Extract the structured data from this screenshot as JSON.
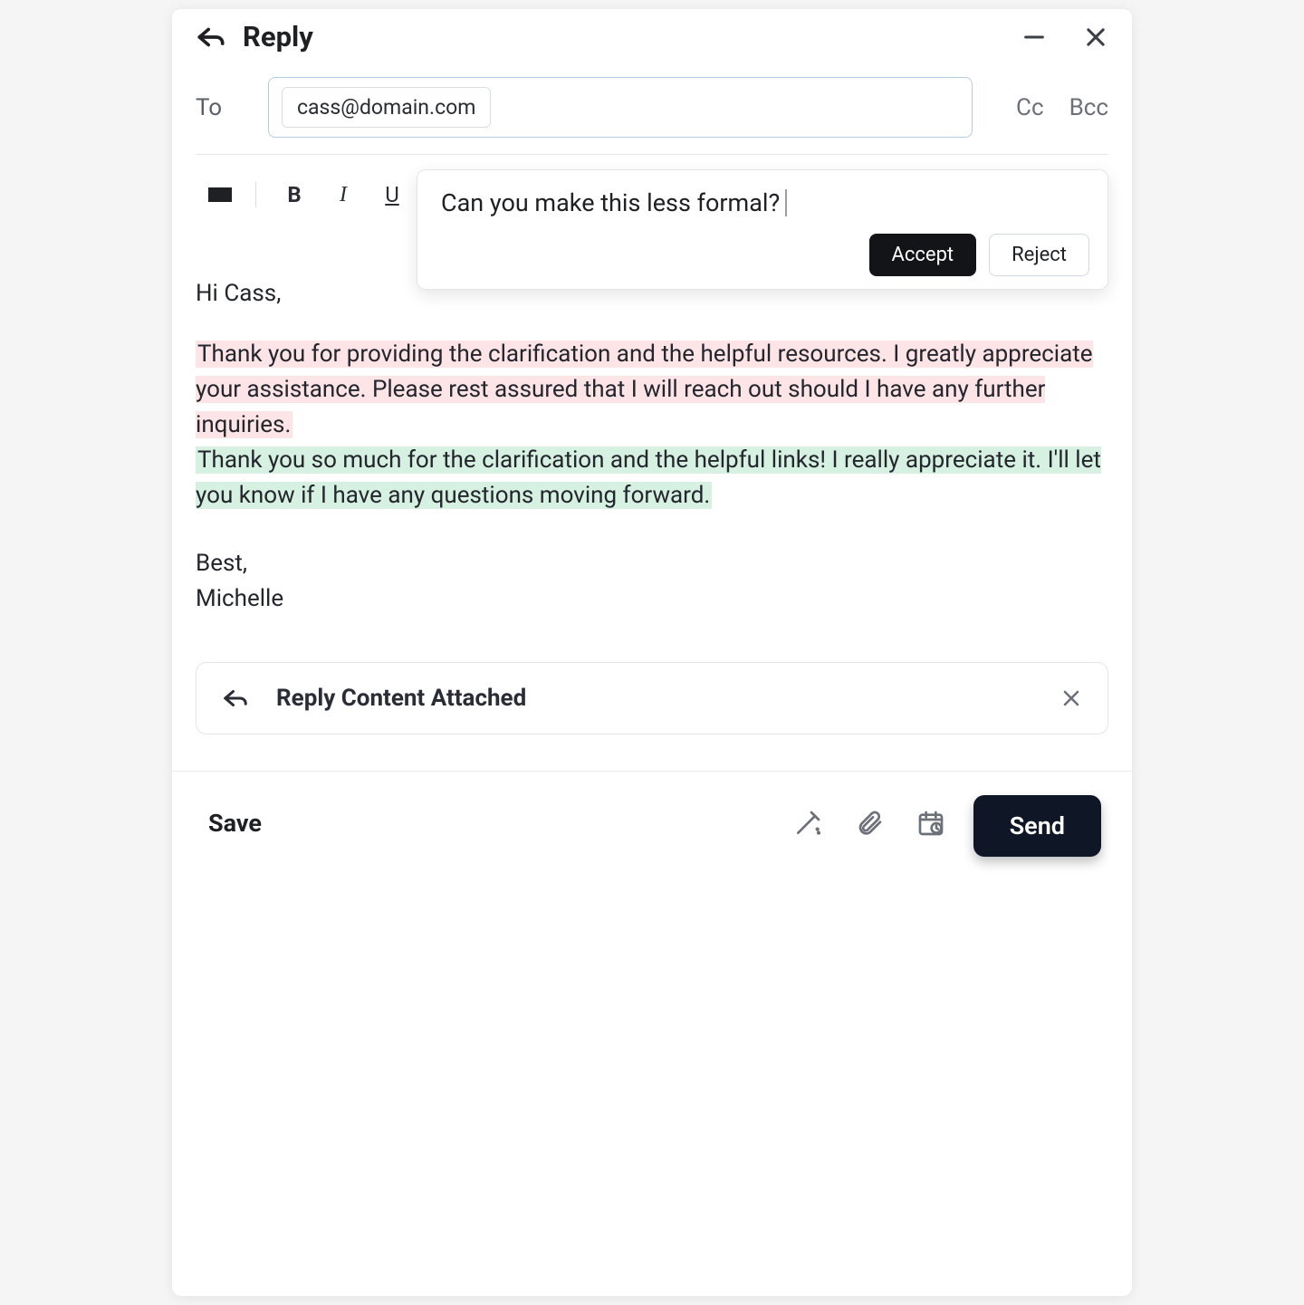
{
  "header": {
    "title": "Reply"
  },
  "recipients": {
    "to_label": "To",
    "chip": "cass@domain.com",
    "cc_label": "Cc",
    "bcc_label": "Bcc"
  },
  "ai": {
    "prompt": "Can you make this less formal?",
    "accept_label": "Accept",
    "reject_label": "Reject"
  },
  "email": {
    "greeting": "Hi Cass,",
    "old_text": "Thank you for providing the clarification and the helpful resources. I greatly appreciate your assistance. Please rest assured that I will reach out should I have any further inquiries.",
    "new_text": "Thank you so much for the clarification and the helpful links! I really appreciate it. I'll let you know if I have any questions moving forward.",
    "signoff1": "Best,",
    "signoff2": "Michelle"
  },
  "attached": {
    "label": "Reply Content Attached"
  },
  "footer": {
    "save_label": "Save",
    "send_label": "Send"
  }
}
